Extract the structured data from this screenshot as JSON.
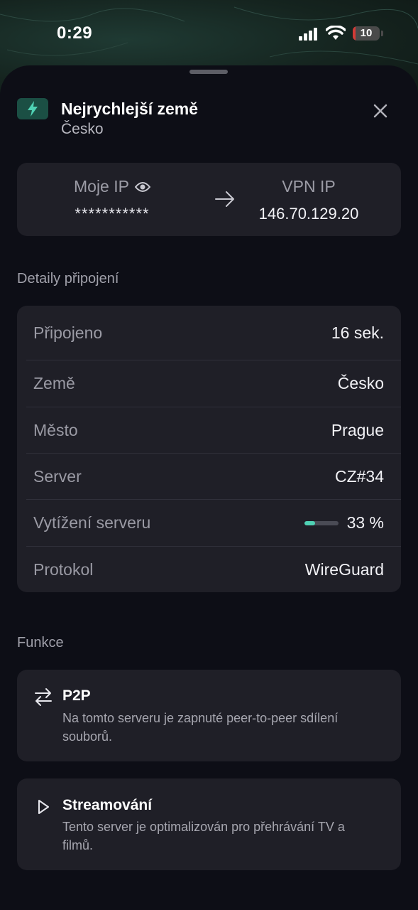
{
  "status_bar": {
    "time": "0:29",
    "battery_level": "10",
    "battery_fraction": 0.1,
    "battery_color": "#d33a36"
  },
  "header": {
    "icon": "bolt-icon",
    "title": "Nejrychlejší země",
    "subtitle": "Česko",
    "close_icon": "close-icon"
  },
  "ip": {
    "my_ip_label": "Moje IP",
    "my_ip_value": "***********",
    "vpn_ip_label": "VPN IP",
    "vpn_ip_value": "146.70.129.20",
    "eye_icon": "eye-icon",
    "arrow_icon": "arrow-right-icon"
  },
  "details": {
    "section_title": "Detaily připojení",
    "rows": [
      {
        "label": "Připojeno",
        "value": "16 sek."
      },
      {
        "label": "Země",
        "value": "Česko"
      },
      {
        "label": "Město",
        "value": "Prague"
      },
      {
        "label": "Server",
        "value": "CZ#34"
      },
      {
        "label": "Vytížení serveru",
        "value": "33 %",
        "load_fraction": 0.33
      },
      {
        "label": "Protokol",
        "value": "WireGuard"
      }
    ]
  },
  "features": {
    "section_title": "Funkce",
    "items": [
      {
        "icon": "swap-arrows-icon",
        "title": "P2P",
        "description": "Na tomto serveru je zapnuté peer-to-peer sdílení souborů."
      },
      {
        "icon": "play-icon",
        "title": "Streamování",
        "description": "Tento server je optimalizován pro přehrávání TV a filmů."
      }
    ]
  },
  "colors": {
    "accent": "#4fd1b4",
    "sheet_bg": "#0d0e16",
    "card_bg": "#1f1f27"
  }
}
